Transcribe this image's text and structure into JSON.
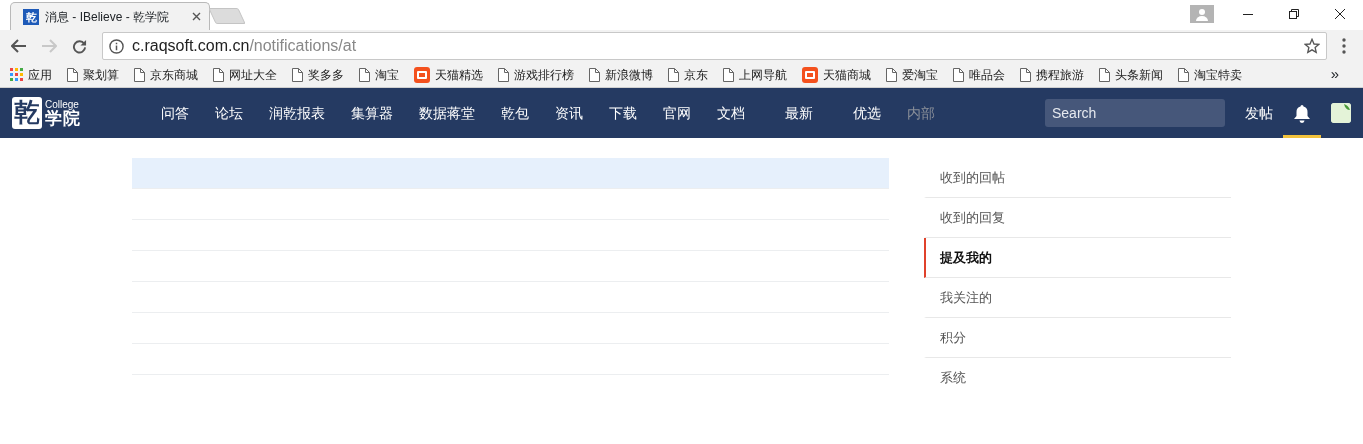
{
  "browser": {
    "tab": {
      "favicon": "乾",
      "title": "消息 - IBelieve - 乾学院"
    },
    "url": {
      "host": "c.raqsoft.com.cn",
      "path": "/notifications/at"
    },
    "bookmarks": [
      {
        "kind": "apps",
        "label": "应用"
      },
      {
        "kind": "page",
        "label": "聚划算"
      },
      {
        "kind": "page",
        "label": "京东商城"
      },
      {
        "kind": "page",
        "label": "网址大全"
      },
      {
        "kind": "page",
        "label": "奖多多"
      },
      {
        "kind": "page",
        "label": "淘宝"
      },
      {
        "kind": "tmall",
        "label": "天猫精选"
      },
      {
        "kind": "page",
        "label": "游戏排行榜"
      },
      {
        "kind": "page",
        "label": "新浪微博"
      },
      {
        "kind": "page",
        "label": "京东"
      },
      {
        "kind": "page",
        "label": "上网导航"
      },
      {
        "kind": "tmall",
        "label": "天猫商城"
      },
      {
        "kind": "page",
        "label": "爱淘宝"
      },
      {
        "kind": "page",
        "label": "唯品会"
      },
      {
        "kind": "page",
        "label": "携程旅游"
      },
      {
        "kind": "page",
        "label": "头条新闻"
      },
      {
        "kind": "page",
        "label": "淘宝特卖"
      }
    ],
    "more": "»"
  },
  "site": {
    "logo": {
      "mark": "乾",
      "sub": "College",
      "name": "学院"
    },
    "nav": [
      {
        "label": "问答",
        "dimmed": false
      },
      {
        "label": "论坛",
        "dimmed": false
      },
      {
        "label": "润乾报表",
        "dimmed": false
      },
      {
        "label": "集算器",
        "dimmed": false
      },
      {
        "label": "数据蒋堂",
        "dimmed": false
      },
      {
        "label": "乾包",
        "dimmed": false
      },
      {
        "label": "资讯",
        "dimmed": false
      },
      {
        "label": "下载",
        "dimmed": false
      },
      {
        "label": "官网",
        "dimmed": false
      },
      {
        "label": "文档",
        "dimmed": false
      },
      {
        "label": "最新",
        "dimmed": false
      },
      {
        "label": "优选",
        "dimmed": false
      },
      {
        "label": "内部",
        "dimmed": true
      }
    ],
    "search": {
      "placeholder": "Search"
    },
    "post": "发帖",
    "notifications": {
      "selected": true
    }
  },
  "notifications": [
    {
      "selected": true
    },
    {
      "selected": false
    },
    {
      "selected": false
    },
    {
      "selected": false
    },
    {
      "selected": false
    },
    {
      "selected": false
    },
    {
      "selected": false
    }
  ],
  "sidebar": {
    "items": [
      {
        "label": "收到的回帖",
        "selected": false
      },
      {
        "label": "收到的回复",
        "selected": false
      },
      {
        "label": "提及我的",
        "selected": true
      },
      {
        "label": "我关注的",
        "selected": false
      },
      {
        "label": "积分",
        "selected": false
      },
      {
        "label": "系统",
        "selected": false
      }
    ]
  }
}
